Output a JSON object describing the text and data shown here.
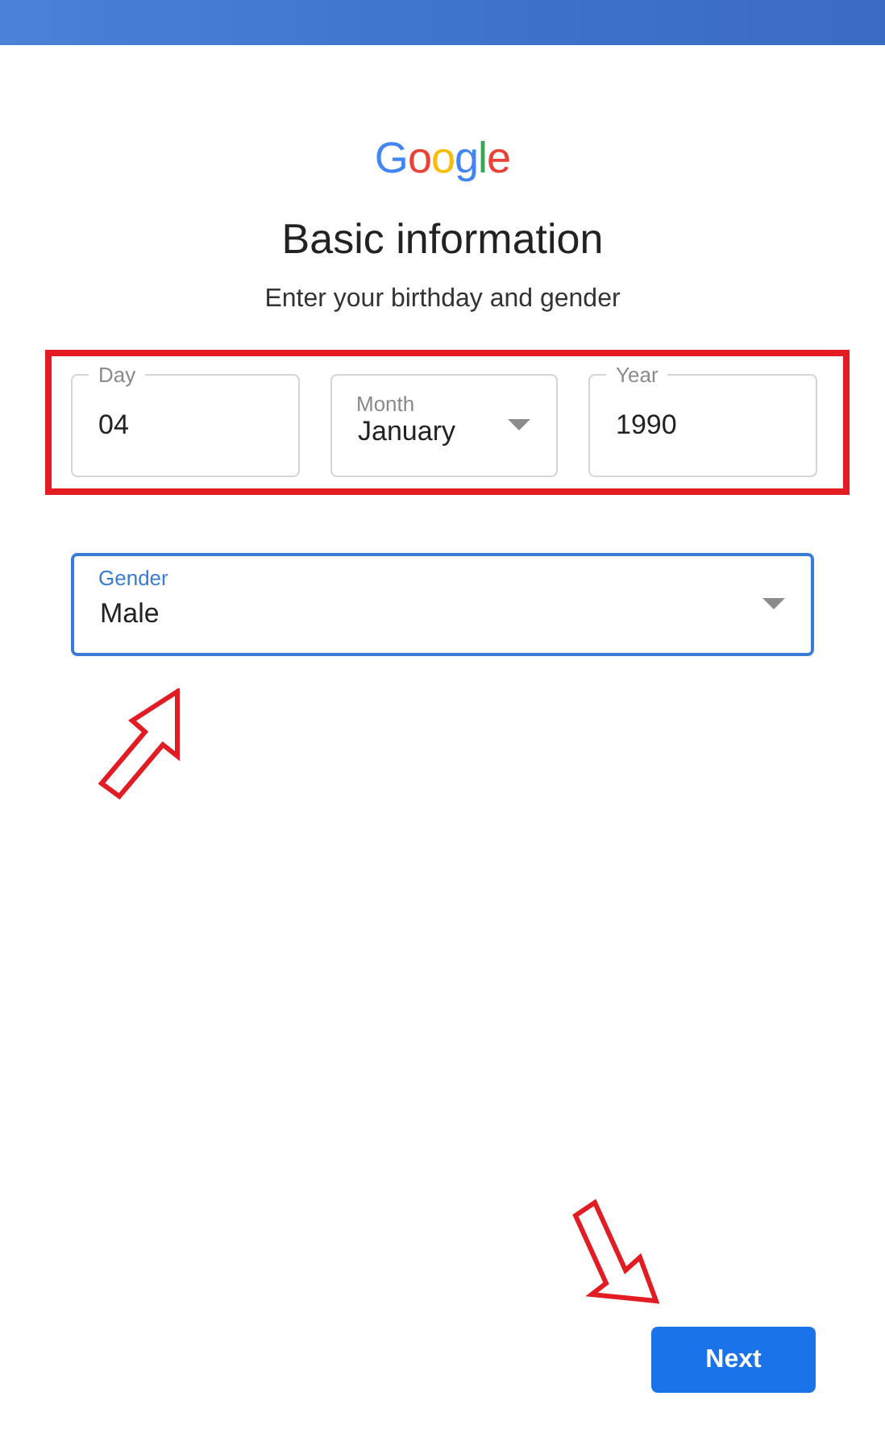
{
  "logo": "Google",
  "title": "Basic information",
  "subtitle": "Enter your birthday and gender",
  "birthday_fields": [
    {
      "kind": "text",
      "label": "Day",
      "value": "04",
      "notched_label": true,
      "focused": false
    },
    {
      "kind": "select",
      "label": "Month",
      "value": "January",
      "notched_label": false,
      "focused": false
    },
    {
      "kind": "text",
      "label": "Year",
      "value": "1990",
      "notched_label": true,
      "focused": false
    }
  ],
  "gender_field": {
    "kind": "select",
    "label": "Gender",
    "value": "Male",
    "notched_label": false,
    "focused": true
  },
  "next_button": "Next",
  "annotations": [
    {
      "kind": "frame"
    },
    {
      "kind": "uparrow"
    },
    {
      "kind": "downarrow"
    }
  ]
}
